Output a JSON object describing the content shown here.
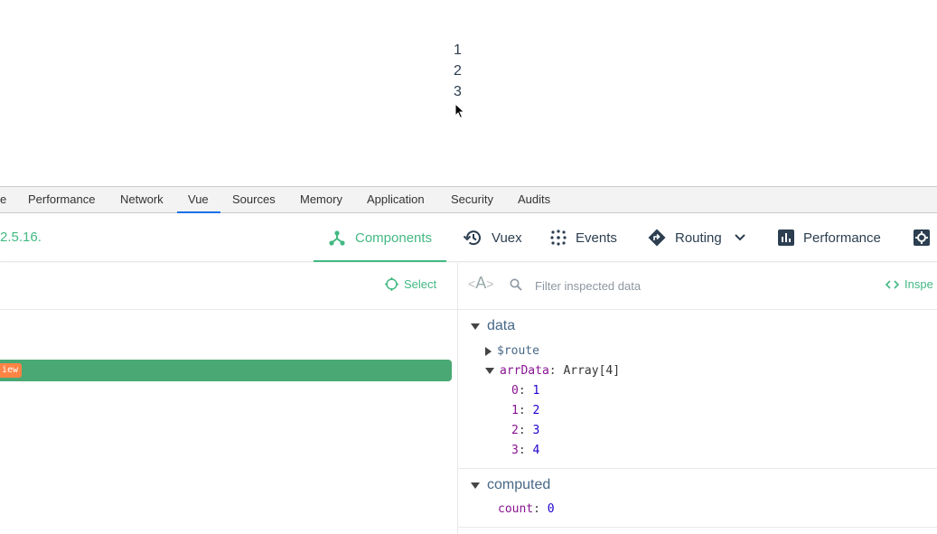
{
  "page": {
    "list_items": [
      "1",
      "2",
      "3"
    ]
  },
  "devtools_tabs": [
    {
      "label": "e"
    },
    {
      "label": "Performance"
    },
    {
      "label": "Network"
    },
    {
      "label": "Vue"
    },
    {
      "label": "Sources"
    },
    {
      "label": "Memory"
    },
    {
      "label": "Application"
    },
    {
      "label": "Security"
    },
    {
      "label": "Audits"
    }
  ],
  "vue": {
    "version": "2.5.16.",
    "nav": {
      "components": "Components",
      "vuex": "Vuex",
      "events": "Events",
      "routing": "Routing",
      "performance": "Performance"
    },
    "accent": "#42b983"
  },
  "left": {
    "select_label": "Select",
    "selected_badge": "iew"
  },
  "right": {
    "filter_placeholder": "Filter inspected data",
    "inspect_label": "Inspe",
    "data_title": "data",
    "route_key": "$route",
    "arr_key": "arrData",
    "arr_type": "Array[4]",
    "arr_items": [
      {
        "index": "0",
        "value": "1"
      },
      {
        "index": "1",
        "value": "2"
      },
      {
        "index": "2",
        "value": "3"
      },
      {
        "index": "3",
        "value": "4"
      }
    ],
    "computed_title": "computed",
    "count_key": "count",
    "count_value": "0"
  }
}
